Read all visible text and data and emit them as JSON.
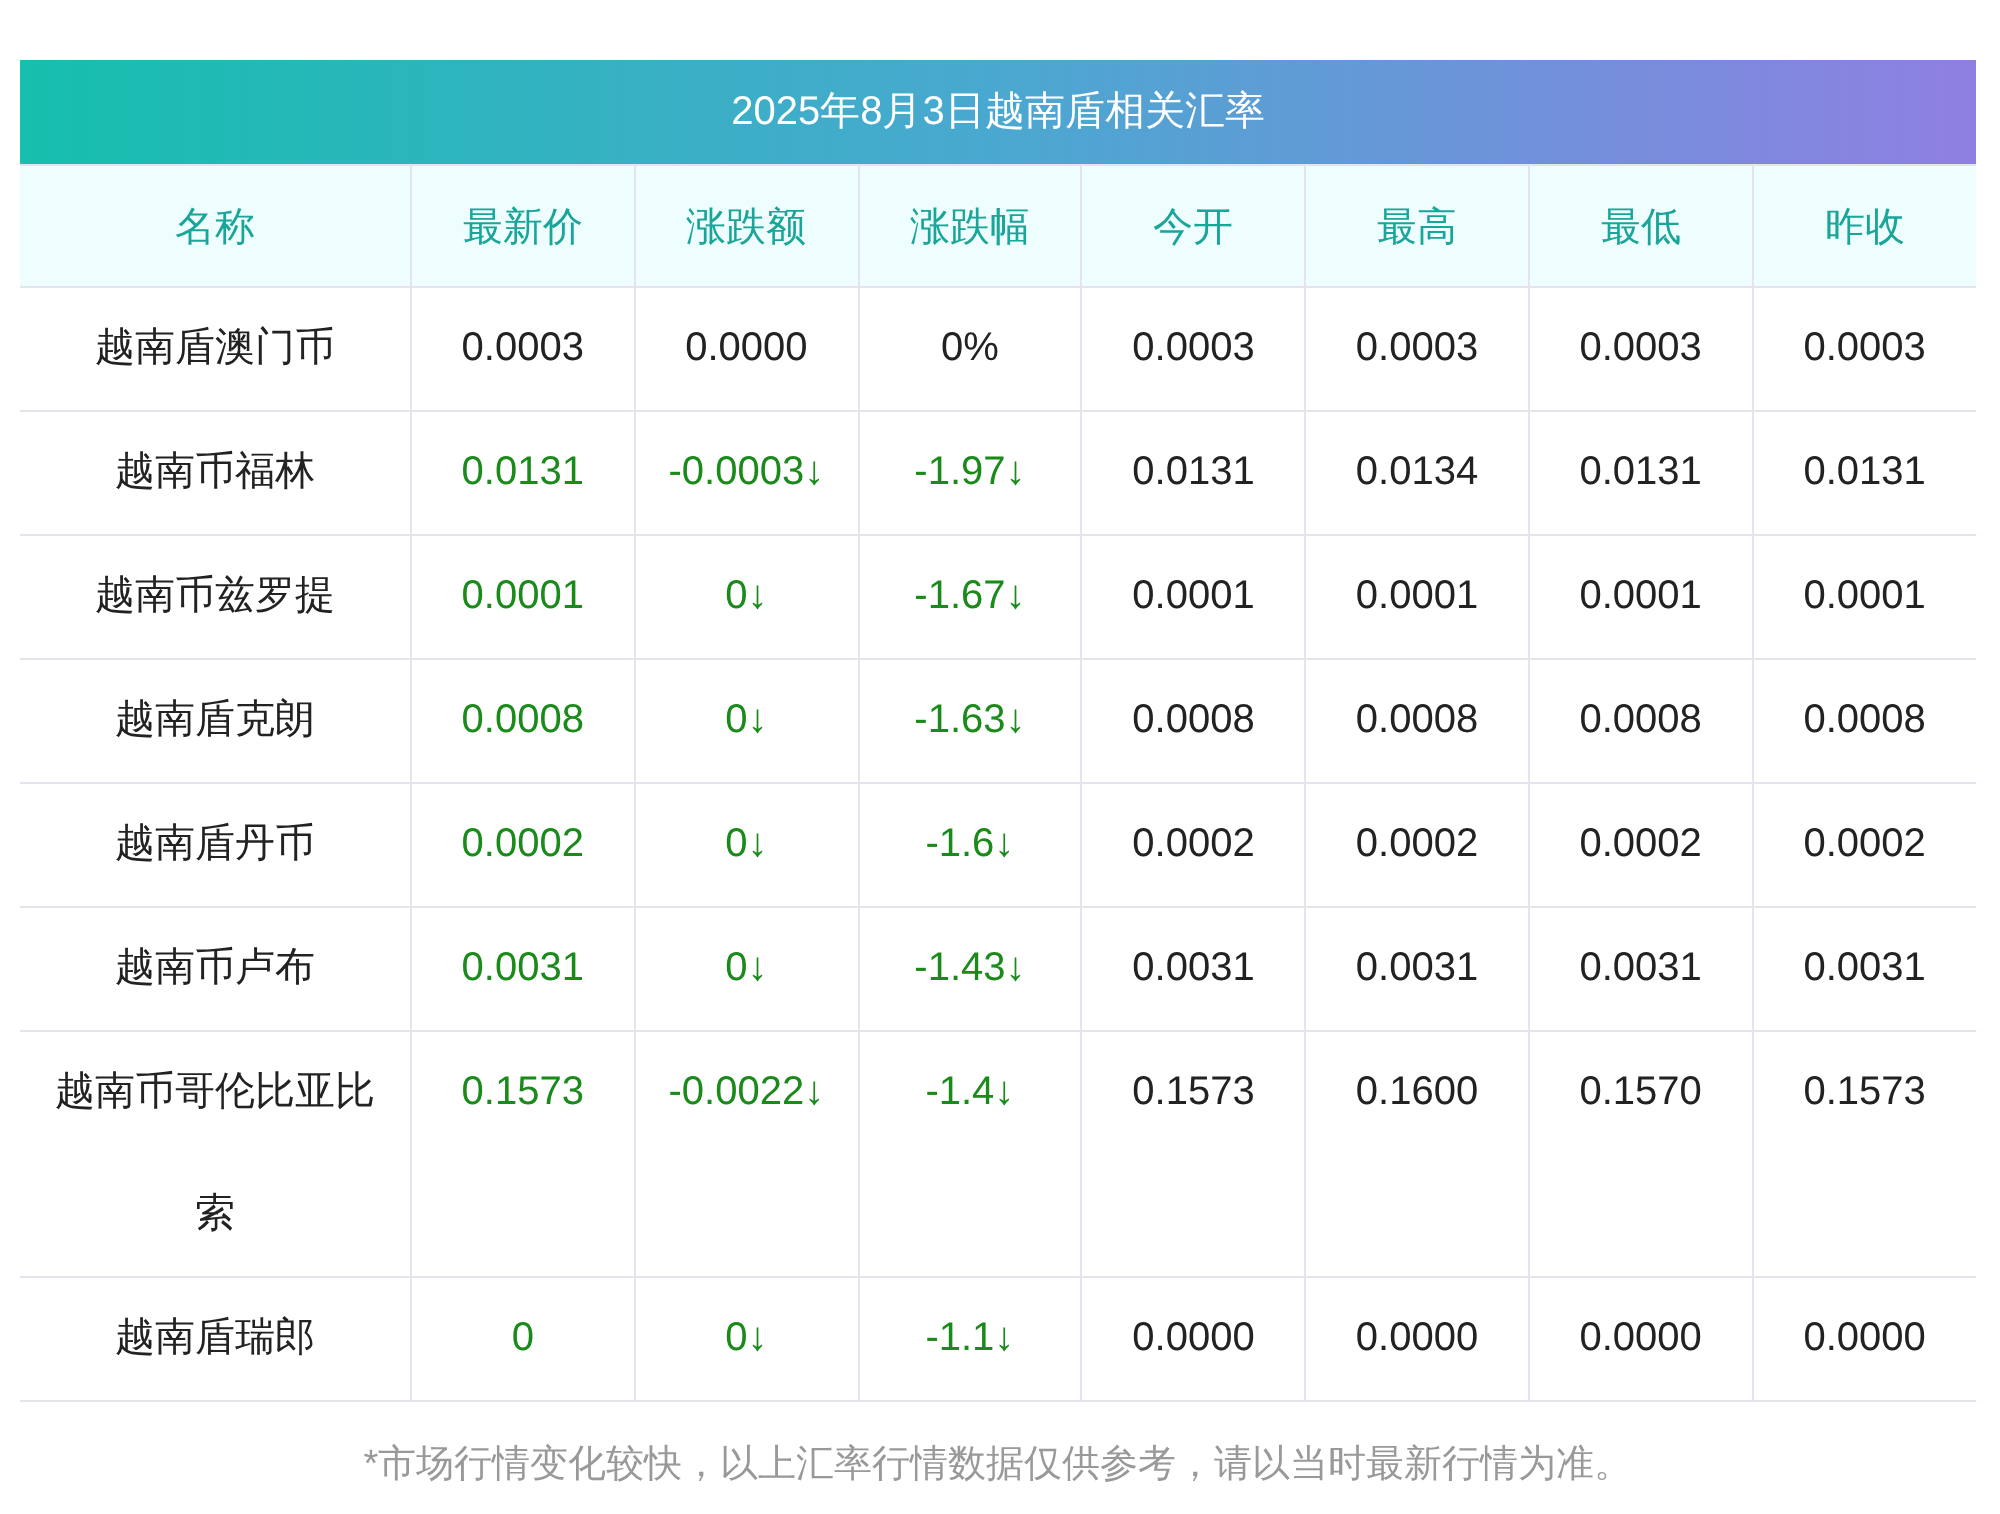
{
  "title": "2025年8月3日越南盾相关汇率",
  "columns": [
    "名称",
    "最新价",
    "涨跌额",
    "涨跌幅",
    "今开",
    "最高",
    "最低",
    "昨收"
  ],
  "rows": [
    {
      "kind": "flat",
      "cells": [
        "越南盾澳门币",
        "0.0003",
        "0.0000",
        "0%",
        "0.0003",
        "0.0003",
        "0.0003",
        "0.0003"
      ]
    },
    {
      "kind": "down",
      "cells": [
        "越南币福林",
        "0.0131",
        "-0.0003↓",
        "-1.97↓",
        "0.0131",
        "0.0134",
        "0.0131",
        "0.0131"
      ]
    },
    {
      "kind": "down",
      "cells": [
        "越南币兹罗提",
        "0.0001",
        "0↓",
        "-1.67↓",
        "0.0001",
        "0.0001",
        "0.0001",
        "0.0001"
      ]
    },
    {
      "kind": "down",
      "cells": [
        "越南盾克朗",
        "0.0008",
        "0↓",
        "-1.63↓",
        "0.0008",
        "0.0008",
        "0.0008",
        "0.0008"
      ]
    },
    {
      "kind": "down",
      "cells": [
        "越南盾丹币",
        "0.0002",
        "0↓",
        "-1.6↓",
        "0.0002",
        "0.0002",
        "0.0002",
        "0.0002"
      ]
    },
    {
      "kind": "down",
      "cells": [
        "越南币卢布",
        "0.0031",
        "0↓",
        "-1.43↓",
        "0.0031",
        "0.0031",
        "0.0031",
        "0.0031"
      ]
    },
    {
      "kind": "down",
      "cells": [
        "越南币哥伦比亚比索",
        "0.1573",
        "-0.0022↓",
        "-1.4↓",
        "0.1573",
        "0.1600",
        "0.1570",
        "0.1573"
      ]
    },
    {
      "kind": "down",
      "cells": [
        "越南盾瑞郎",
        "0",
        "0↓",
        "-1.1↓",
        "0.0000",
        "0.0000",
        "0.0000",
        "0.0000"
      ]
    }
  ],
  "footnote": "*市场行情变化较快，以上汇率行情数据仅供参考，请以当时最新行情为准。"
}
